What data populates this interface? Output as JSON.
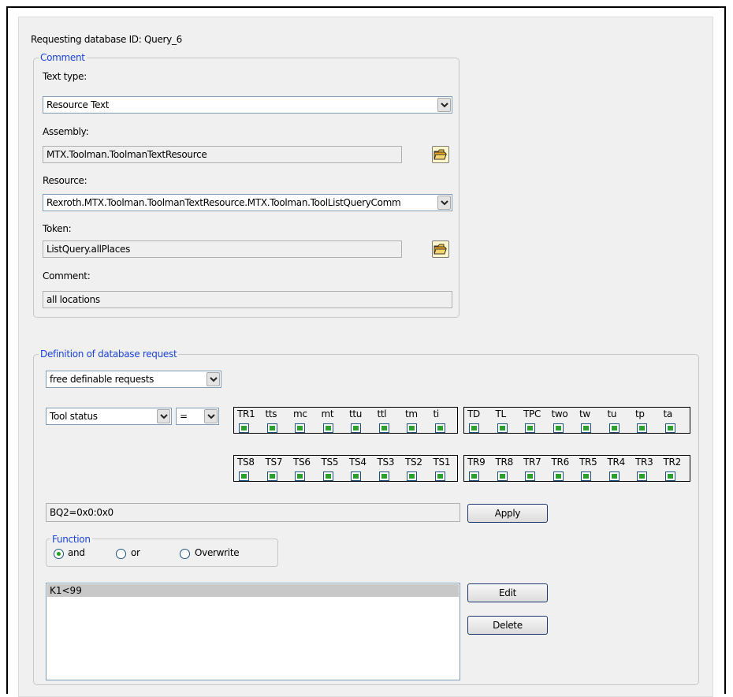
{
  "header": {
    "text": "Requesting database ID: Query_6"
  },
  "comment_group": {
    "legend": "Comment",
    "text_type_label": "Text type:",
    "text_type_value": "Resource Text",
    "assembly_label": "Assembly:",
    "assembly_value": "MTX.Toolman.ToolmanTextResource",
    "resource_label": "Resource:",
    "resource_value": "Rexroth.MTX.Toolman.ToolmanTextResource.MTX.Toolman.ToolListQueryComm",
    "token_label": "Token:",
    "token_value": "ListQuery.allPlaces",
    "comment_label": "Comment:",
    "comment_value": "all locations"
  },
  "request_group": {
    "legend": "Definition of database request",
    "request_type": "free definable requests",
    "field_select": "Tool status",
    "operator_select": "=",
    "bit_boxes": [
      {
        "labels": [
          "TR1",
          "tts",
          "mc",
          "mt",
          "ttu",
          "ttl",
          "tm",
          "ti"
        ]
      },
      {
        "labels": [
          "TD",
          "TL",
          "TPC",
          "two",
          "tw",
          "tu",
          "tp",
          "ta"
        ]
      },
      {
        "labels": [
          "TS8",
          "TS7",
          "TS6",
          "TS5",
          "TS4",
          "TS3",
          "TS2",
          "TS1"
        ]
      },
      {
        "labels": [
          "TR9",
          "TR8",
          "TR7",
          "TR6",
          "TR5",
          "TR4",
          "TR3",
          "TR2"
        ]
      }
    ],
    "expression_value": "BQ2=0x0:0x0",
    "apply_label": "Apply",
    "function_legend": "Function",
    "function_options": [
      "and",
      "or",
      "Overwrite"
    ],
    "function_selected": "and",
    "conditions": [
      "K1<99"
    ],
    "edit_label": "Edit",
    "delete_label": "Delete"
  },
  "colors": {
    "legend": "#1c44d9",
    "checkbox_fill": "#2ca02c",
    "pane": "#f0f0f0"
  }
}
